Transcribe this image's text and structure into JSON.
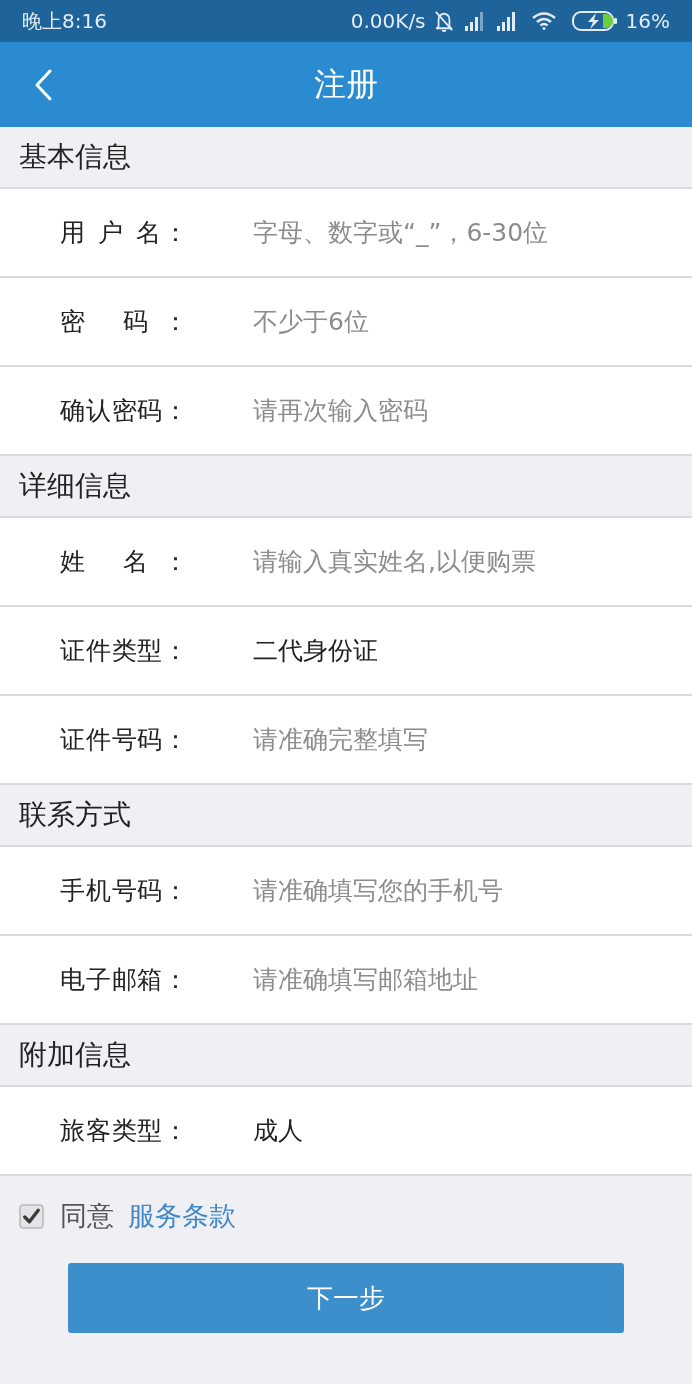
{
  "status_bar": {
    "time": "晚上8:16",
    "network_speed": "0.00K/s",
    "battery": "16%"
  },
  "nav_bar": {
    "title": "注册"
  },
  "sections": [
    {
      "title": "基本信息",
      "fields": [
        {
          "kind": "input",
          "label": "用 户 名：",
          "placeholder": "字母、数字或“_”，6-30位"
        },
        {
          "kind": "input",
          "label": "密 码：",
          "placeholder": "不少于6位"
        },
        {
          "kind": "input",
          "label": "确认密码：",
          "placeholder": "请再次输入密码"
        }
      ]
    },
    {
      "title": "详细信息",
      "fields": [
        {
          "kind": "input",
          "label": "姓 名：",
          "placeholder": "请输入真实姓名,以便购票"
        },
        {
          "kind": "picker",
          "label": "证件类型：",
          "value": "二代身份证"
        },
        {
          "kind": "input",
          "label": "证件号码：",
          "placeholder": "请准确完整填写"
        }
      ]
    },
    {
      "title": "联系方式",
      "fields": [
        {
          "kind": "input",
          "label": "手机号码：",
          "placeholder": "请准确填写您的手机号"
        },
        {
          "kind": "input",
          "label": "电子邮箱：",
          "placeholder": "请准确填写邮箱地址"
        }
      ]
    },
    {
      "title": "附加信息",
      "fields": [
        {
          "kind": "picker",
          "label": "旅客类型：",
          "value": "成人"
        }
      ]
    }
  ],
  "agreement": {
    "checked": true,
    "text": "同意",
    "link": "服务条款"
  },
  "next_button": {
    "label": "下一步"
  }
}
